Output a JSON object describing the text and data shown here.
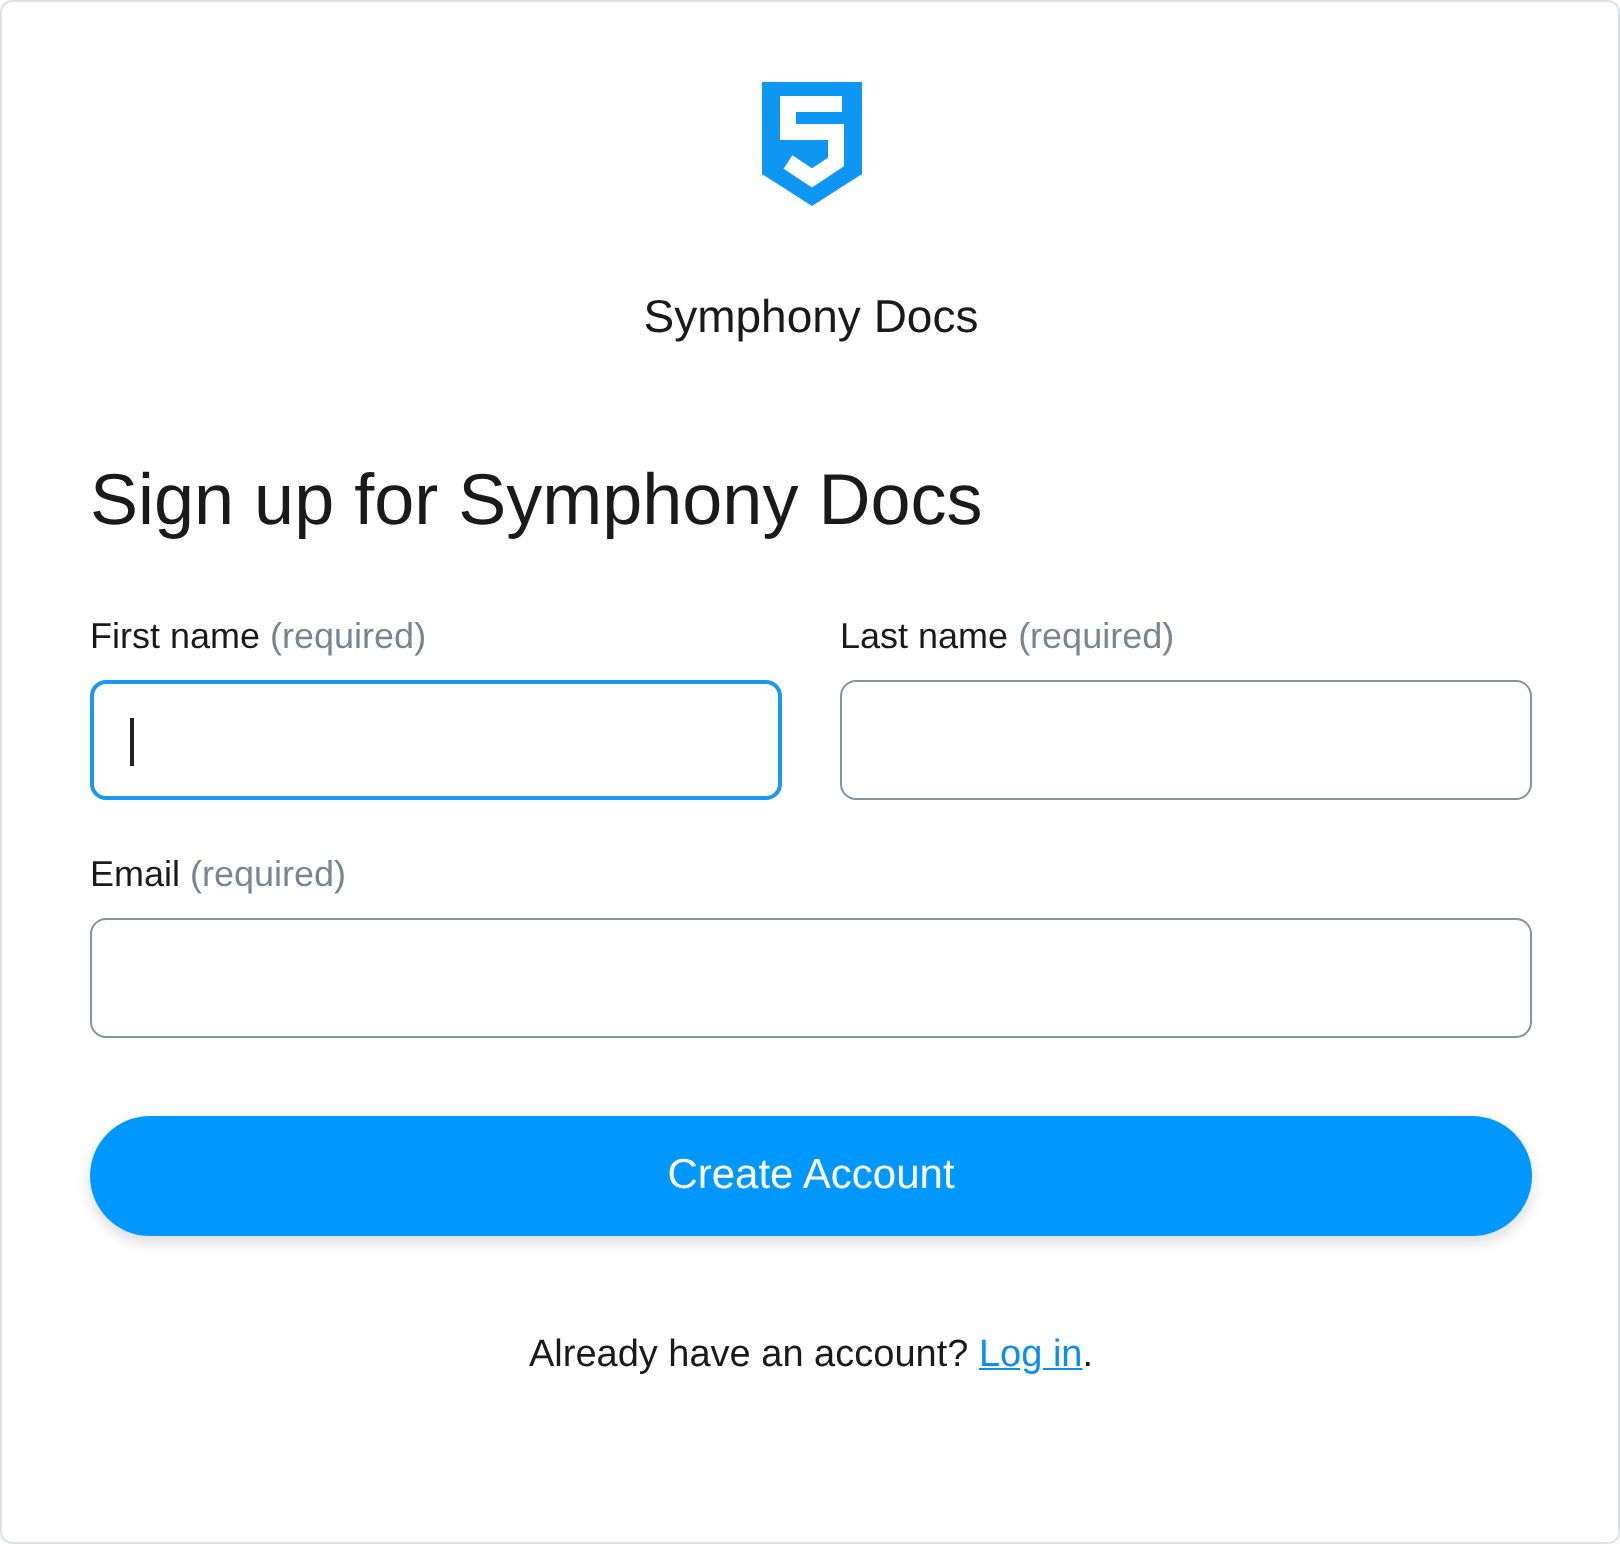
{
  "brand": {
    "name": "Symphony Docs"
  },
  "heading": "Sign up for Symphony Docs",
  "fields": [
    {
      "label": "First name",
      "hint": "(required)",
      "focused": true
    },
    {
      "label": "Last name",
      "hint": "(required)",
      "focused": false
    },
    {
      "label": "Email",
      "hint": "(required)",
      "focused": false
    }
  ],
  "button": "Create Account",
  "footer": {
    "text": "Already have an account?",
    "link": "Log in",
    "after": "."
  }
}
